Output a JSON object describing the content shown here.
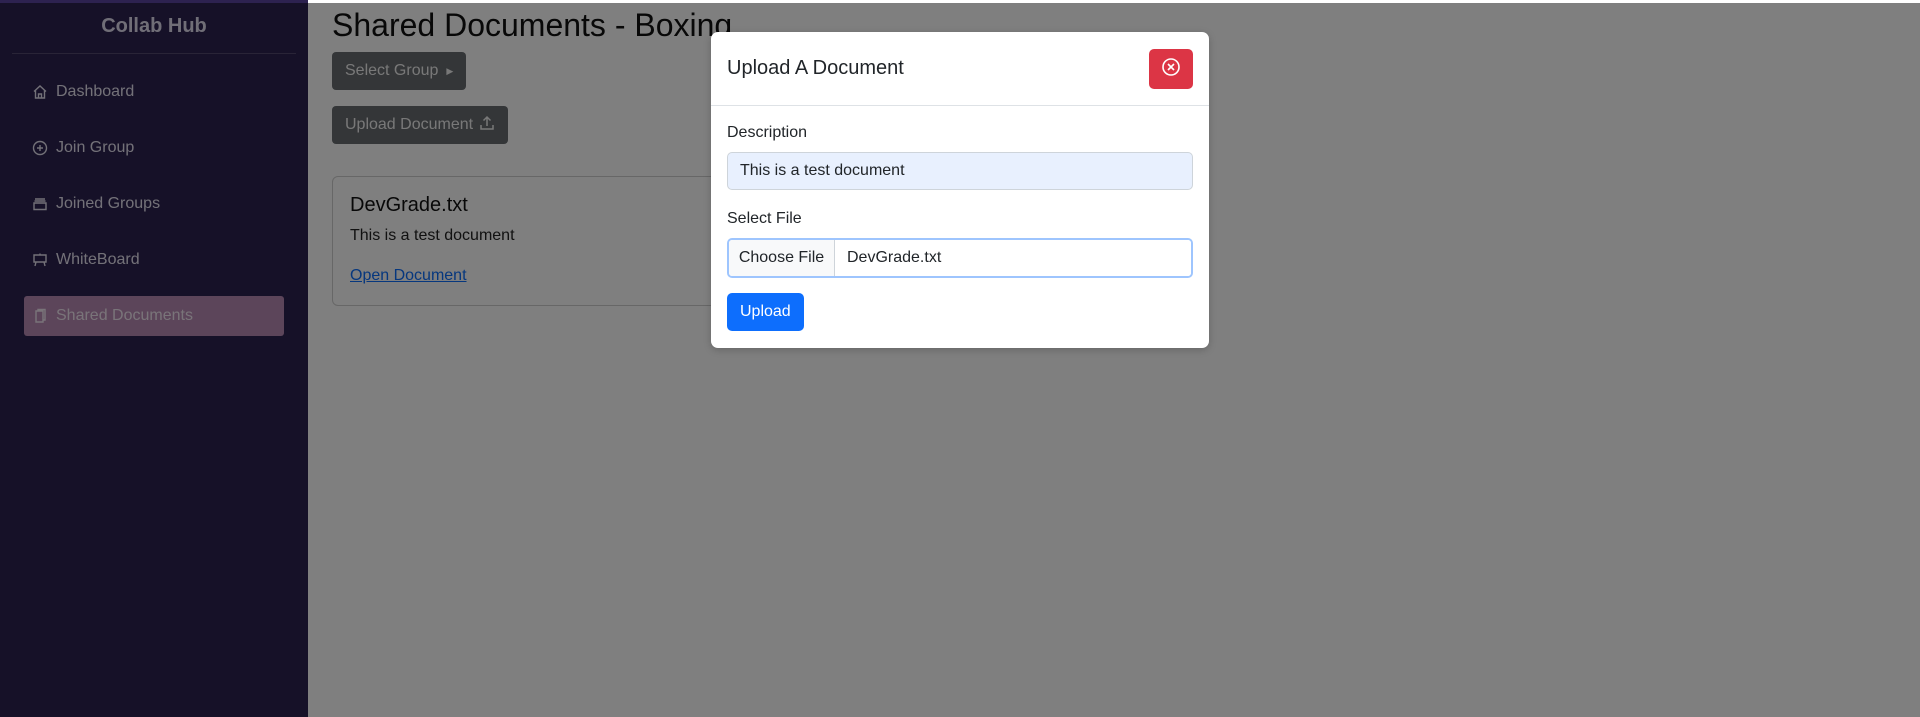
{
  "sidebar": {
    "brand": "Collab Hub",
    "items": [
      {
        "label": "Dashboard",
        "icon": "house-icon"
      },
      {
        "label": "Join Group",
        "icon": "plus-circle-icon"
      },
      {
        "label": "Joined Groups",
        "icon": "archive-icon"
      },
      {
        "label": "WhiteBoard",
        "icon": "easel-icon"
      },
      {
        "label": "Shared Documents",
        "icon": "documents-icon",
        "active": true
      }
    ]
  },
  "main": {
    "title": "Shared Documents - Boxing",
    "select_group_label": "Select Group",
    "upload_document_label": "Upload Document",
    "documents": [
      {
        "title": "DevGrade.txt",
        "description": "This is a test document",
        "link_label": "Open Document"
      }
    ]
  },
  "modal": {
    "title": "Upload A Document",
    "description_label": "Description",
    "description_value": "This is a test document",
    "select_file_label": "Select File",
    "choose_file_label": "Choose File",
    "file_name": "DevGrade.txt",
    "upload_label": "Upload"
  },
  "colors": {
    "sidebar_bg": "#2d2250",
    "active_item": "#b98ab5",
    "primary": "#0d6efd",
    "danger": "#dc3545"
  }
}
